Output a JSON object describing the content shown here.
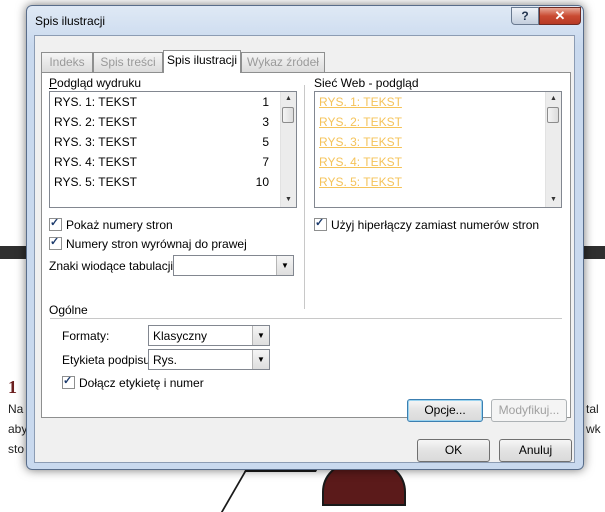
{
  "background_doc": {
    "heading_number": "1",
    "line1_left": "Na",
    "line1_right": "tal",
    "line2_left": "aby",
    "line2_right": "wk",
    "line3_left": "sto"
  },
  "dialog": {
    "title": "Spis ilustracji",
    "help_glyph": "?",
    "close_glyph": "✕"
  },
  "tabs": [
    {
      "label": "Indeks",
      "active": false
    },
    {
      "label": "Spis treści",
      "active": false
    },
    {
      "label": "Spis ilustracji",
      "active": true
    },
    {
      "label": "Wykaz źródeł",
      "active": false
    }
  ],
  "print_preview": {
    "label": "Podgląd wydruku",
    "items": [
      {
        "text": "RYS. 1: TEKST",
        "page": "1"
      },
      {
        "text": "RYS. 2: TEKST",
        "page": "3"
      },
      {
        "text": "RYS. 3: TEKST",
        "page": "5"
      },
      {
        "text": "RYS. 4: TEKST",
        "page": "7"
      },
      {
        "text": "RYS. 5: TEKST",
        "page": "10"
      }
    ]
  },
  "web_preview": {
    "label": "Sieć Web - podgląd",
    "items": [
      "RYS. 1: TEKST",
      "RYS. 2: TEKST",
      "RYS. 3: TEKST",
      "RYS. 4: TEKST",
      "RYS. 5: TEKST"
    ],
    "link_color": "#f5c35a"
  },
  "options": {
    "show_page_numbers": "Pokaż numery stron",
    "right_align": "Numery stron wyrównaj do prawej",
    "tab_leader_label": "Znaki wiodące tabulacji:",
    "tab_leader_value": "",
    "use_hyperlinks": "Użyj hiperłączy zamiast numerów stron"
  },
  "general": {
    "label": "Ogólne",
    "formats_label": "Formaty:",
    "formats_value": "Klasyczny",
    "caption_label": "Etykieta podpisu:",
    "caption_value": "Rys.",
    "include_label": "Dołącz etykietę i numer"
  },
  "buttons": {
    "options": "Opcje...",
    "modify": "Modyfikuj...",
    "ok": "OK",
    "cancel": "Anuluj"
  }
}
